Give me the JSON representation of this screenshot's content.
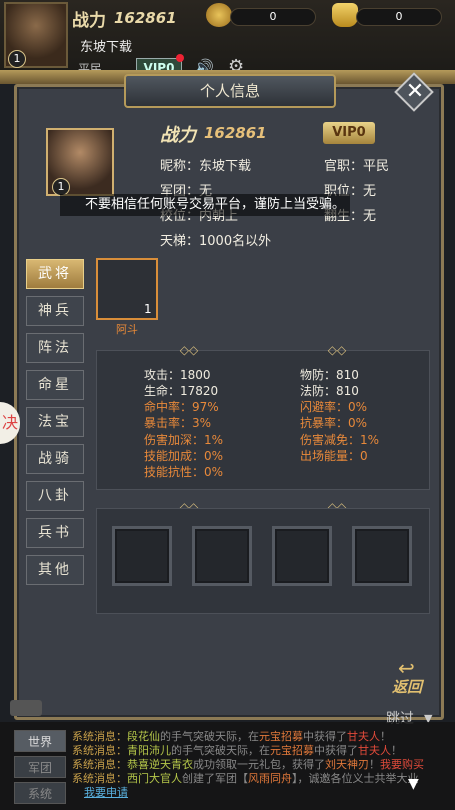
{
  "hud": {
    "power_label": "战力",
    "power_value": "162861",
    "level": "1",
    "player_name": "东坡下载",
    "rank": "平民",
    "vip": "VIP0",
    "coin": "0",
    "ingot": "0"
  },
  "panel": {
    "title": "个人信息",
    "close": "✕"
  },
  "profile": {
    "level": "1",
    "power_label": "战力",
    "power_value": "162861",
    "vip": "VIP0",
    "nickname": "昵称：东坡下载",
    "official": "官职：平民",
    "legion": "军团：无",
    "post": "职位：无",
    "school": "校位：内朝上",
    "rebirth": "翻生：无",
    "ladder": "天梯：1000名以外"
  },
  "notice": "不要相信任何账号交易平台，谨防上当受骗。",
  "tabs": [
    "武将",
    "神兵",
    "阵法",
    "命星",
    "法宝",
    "战骑",
    "八卦",
    "兵书",
    "其他"
  ],
  "side_tab": "决",
  "hero": {
    "count": "1",
    "name": "阿斗"
  },
  "stats": {
    "attack": "攻击：1800",
    "pdef": "物防：810",
    "hp": "生命：17820",
    "mdef": "法防：810",
    "hit": "命中率：97%",
    "dodge": "闪避率：0%",
    "crit": "暴击率：3%",
    "anticrit": "抗暴率：0%",
    "dmgup": "伤害加深：1%",
    "dmgdown": "伤害减免：1%",
    "skillup": "技能加成：0%",
    "energy": "出场能量：0",
    "skillres": "技能抗性：0%"
  },
  "back": {
    "label": "返回",
    "arrow": "↩"
  },
  "skip": {
    "label": "跳过",
    "arrow": "▼"
  },
  "chat": {
    "channels": [
      "世界",
      "军团",
      "系统"
    ],
    "lines": [
      {
        "sys": "系统消息：",
        "name": "段花仙",
        "t1": "的手气突破天际，在",
        "place": "元宝招募",
        "t2": "中获得了",
        "item": "甘夫人",
        "t3": "！"
      },
      {
        "sys": "系统消息：",
        "name": "青阳沛儿",
        "t1": "的手气突破天际，在",
        "place": "元宝招募",
        "t2": "中获得了",
        "item": "甘夫人",
        "t3": "！"
      },
      {
        "sys": "系统消息：",
        "name": "恭喜逆天青衣",
        "t1": "成功领取一元礼包，获得了",
        "place": "刘天神刃",
        "t2": "！",
        "item": "我要购买",
        "t3": ""
      },
      {
        "sys": "系统消息：",
        "name": "西门大官人",
        "t1": "创建了军团【",
        "place": "风雨同舟",
        "t2": "】，诚邀各位义士共",
        "item": "",
        "t3": "举大业"
      }
    ],
    "apply": "我要申请",
    "down": "▼"
  }
}
